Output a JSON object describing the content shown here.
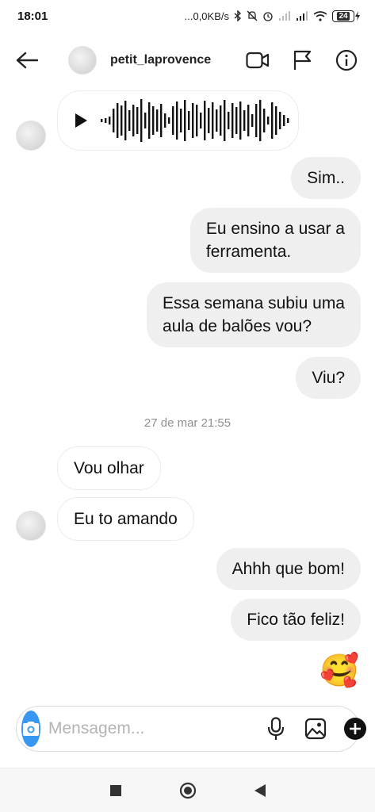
{
  "status_bar": {
    "time": "18:01",
    "network_speed": "...0,0KB/s",
    "battery_level": "24",
    "icons": [
      "bluetooth-icon",
      "mute-icon",
      "alarm-icon",
      "signal-icon",
      "signal-icon",
      "wifi-icon",
      "battery-icon"
    ]
  },
  "header": {
    "username": "petit_laprovence",
    "icons": [
      "back-arrow-icon",
      "video-call-icon",
      "flag-icon",
      "info-icon"
    ]
  },
  "messages": [
    {
      "type": "audio",
      "direction": "incoming"
    },
    {
      "type": "text",
      "direction": "outgoing",
      "text": "Sim.."
    },
    {
      "type": "text",
      "direction": "outgoing",
      "lines": [
        "Eu ensino a usar a",
        "ferramenta."
      ]
    },
    {
      "type": "text",
      "direction": "outgoing",
      "lines": [
        "Essa semana subiu uma",
        "aula de balões vou?"
      ]
    },
    {
      "type": "text",
      "direction": "outgoing",
      "text": "Viu?"
    },
    {
      "type": "timestamp",
      "text": "27 de mar 21:55"
    },
    {
      "type": "text",
      "direction": "incoming",
      "text": "Vou olhar"
    },
    {
      "type": "text",
      "direction": "incoming",
      "text": "Eu to amando"
    },
    {
      "type": "text",
      "direction": "outgoing",
      "text": "Ahhh que bom!"
    },
    {
      "type": "text",
      "direction": "outgoing",
      "text": "Fico tão feliz!"
    },
    {
      "type": "emoji",
      "direction": "outgoing",
      "text": "🥰"
    }
  ],
  "composer": {
    "placeholder": "Mensagem...",
    "value": "",
    "icons": [
      "camera-icon",
      "microphone-icon",
      "gallery-icon",
      "plus-icon"
    ]
  },
  "nav_bar": {
    "icons": [
      "recent-apps-icon",
      "home-icon",
      "back-icon"
    ]
  },
  "colors": {
    "accent": "#3897f0",
    "bubble_out": "#efefef",
    "bubble_in_border": "#ececec",
    "timestamp": "#8e8e8e"
  }
}
